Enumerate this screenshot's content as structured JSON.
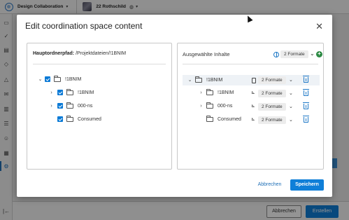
{
  "app": {
    "name": "Design Collaboration",
    "project": "22 Rothschild"
  },
  "background": {
    "cancel_label": "Abbrechen",
    "create_label": "Erstellen"
  },
  "modal": {
    "title": "Edit coordination space content",
    "left": {
      "path_label": "Hauptordnerpfad:",
      "path_value": "/Projektdateien/!1BNIM",
      "tree": [
        {
          "label": "!1BNIM",
          "level": 0,
          "expanded": true
        },
        {
          "label": "!1BNIM",
          "level": 1,
          "expanded": false
        },
        {
          "label": "000-ns",
          "level": 1,
          "expanded": false
        },
        {
          "label": "Consumed",
          "level": 1,
          "expanded": null
        }
      ]
    },
    "right": {
      "title": "Ausgewählte Inhalte",
      "formats_label": "2 Formate",
      "items": [
        {
          "label": "!1BNIM",
          "formats": "2 Formate"
        },
        {
          "label": "!1BNIM",
          "formats": "2 Formate"
        },
        {
          "label": "000-ns",
          "formats": "2 Formate"
        },
        {
          "label": "Consumed",
          "formats": "2 Formate"
        }
      ]
    },
    "cancel_label": "Abbrechen",
    "save_label": "Speichern"
  },
  "colors": {
    "accent": "#0f7fd8",
    "checkbox": "#0a7ad6",
    "add": "#2c8a44"
  }
}
